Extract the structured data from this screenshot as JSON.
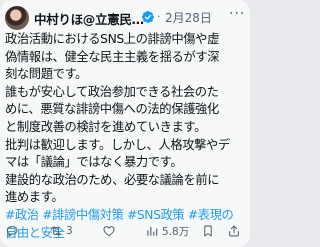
{
  "post": {
    "author_name": "中村りほ@立憲民…",
    "dot": "·",
    "date": "2月28日",
    "more_label": "···",
    "lines": [
      "政治活動におけるSNS上の誹謗中傷や虚",
      "偽情報は、健全な民主主義を揺るがす深",
      "刻な問題です。",
      "誰もが安心して政治参加できる社会のた",
      "めに、悪質な誹謗中傷への法的保護強化",
      "と制度改善の検討を進めていきます。",
      "批判は歓迎します。しかし、人格攻撃やデ",
      "マは「議論」ではなく暴力です。",
      "建設的な政治のため、必要な議論を前に",
      "進めます。"
    ],
    "hashtags": [
      "#政治 #誹謗中傷対策 #SNS政策 #表現の",
      "自由と安全"
    ]
  },
  "actions": {
    "reply_icon": "reply-icon",
    "retweet_icon": "retweet-icon",
    "retweet_count": "3",
    "like_icon": "heart-icon",
    "views_icon": "views-icon",
    "views_count": "5.8万",
    "bookmark_icon": "bookmark-icon",
    "share_icon": "share-icon"
  },
  "colors": {
    "accent": "#1d9bf0",
    "muted": "#536471",
    "text": "#0f1419",
    "background": "#f7f9f9"
  }
}
